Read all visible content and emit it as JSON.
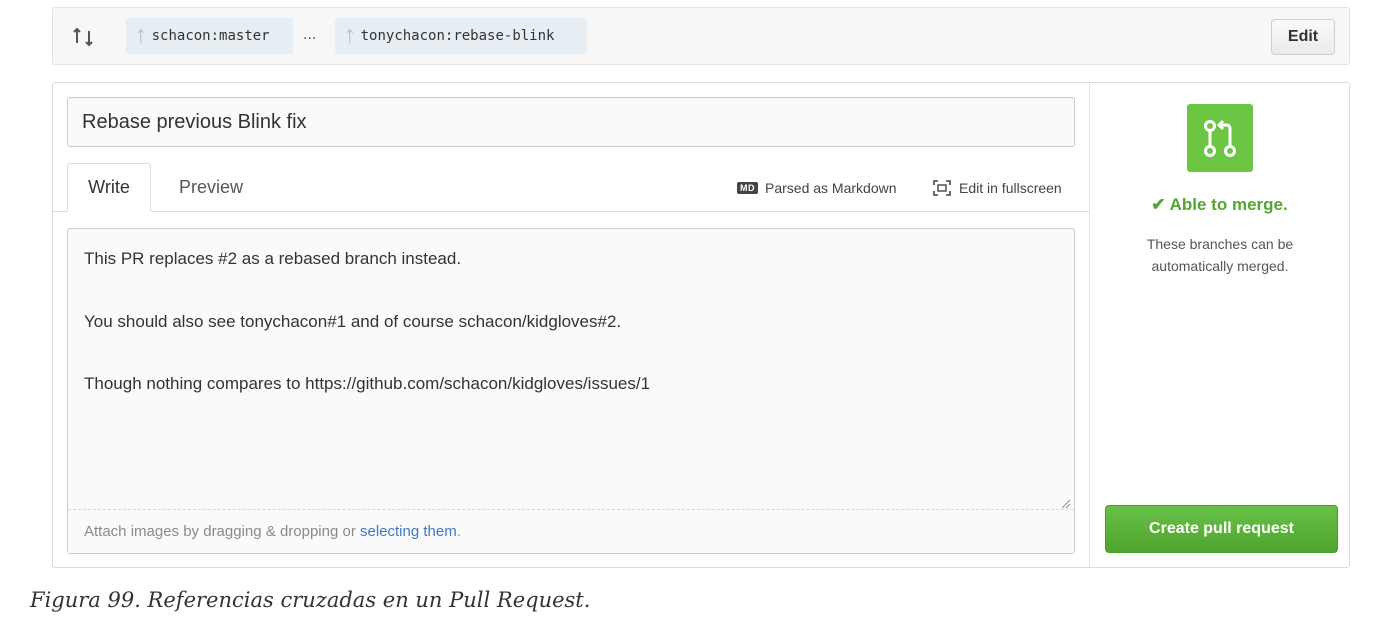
{
  "branch_bar": {
    "base_branch": "schacon:master",
    "separator": "...",
    "head_branch": "tonychacon:rebase-blink",
    "edit_label": "Edit"
  },
  "form": {
    "title_value": "Rebase previous Blink fix",
    "tabs": [
      {
        "label": "Write",
        "active": true
      },
      {
        "label": "Preview",
        "active": false
      }
    ],
    "markdown_badge": "MD",
    "markdown_note": "Parsed as Markdown",
    "fullscreen_label": "Edit in fullscreen",
    "body_lines": [
      "This PR replaces #2 as a rebased branch instead.",
      "You should also see tonychacon#1 and of course schacon/kidgloves#2.",
      "Though nothing compares to https://github.com/schacon/kidgloves/issues/1"
    ],
    "attach_text": "Attach images by dragging & dropping or ",
    "attach_link": "selecting them",
    "attach_end": "."
  },
  "sidebar": {
    "merge_status": "✔ Able to merge.",
    "merge_description": "These branches can be automatically merged.",
    "create_button": "Create pull request"
  },
  "caption": "Figura 99. Referencias cruzadas en un Pull Request.",
  "colors": {
    "merge_green": "#6cc644",
    "status_green": "#55a532",
    "link_blue": "#4078c0"
  },
  "icons": [
    "compare-icon",
    "branch-icon",
    "markdown-icon",
    "fullscreen-icon",
    "resize-grip-icon",
    "pull-request-icon"
  ]
}
